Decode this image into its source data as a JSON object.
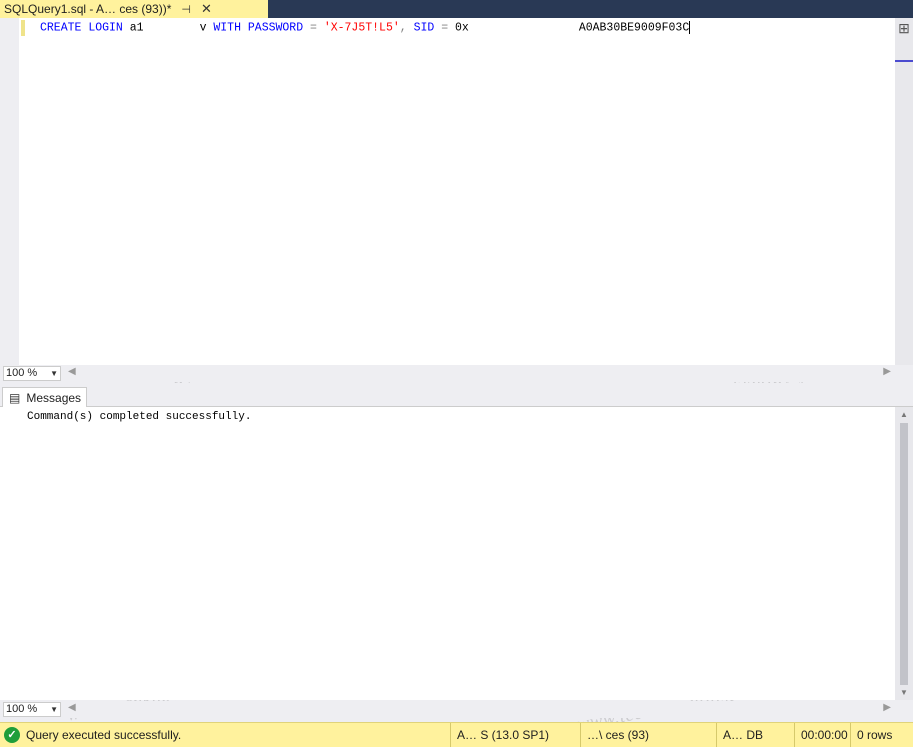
{
  "tab": {
    "title": "SQLQuery1.sql - A…                ces (93))*",
    "pin_glyph": "⊣",
    "close_glyph": "✕"
  },
  "editor": {
    "tokens": {
      "create": "CREATE",
      "login": "LOGIN",
      "name_part1": "a1",
      "name_part2": "v",
      "with": "WITH",
      "password": "PASSWORD",
      "eq1": "=",
      "pwd_value": "'X-7J5T!L5'",
      "comma": ",",
      "sid": "SID",
      "eq2": "=",
      "sid_part1": "0x",
      "sid_part2": "A0AB30BE9009F03C"
    }
  },
  "editor_zoom": {
    "value": "100 %"
  },
  "results": {
    "tab_label": "Messages",
    "message": "Command(s) completed successfully."
  },
  "results_zoom": {
    "value": "100 %"
  },
  "status": {
    "text": "Query executed successfully.",
    "server_version": "A…             S (13.0 SP1)",
    "user": "…\\             ces (93)",
    "database": "A…           DB",
    "elapsed": "00:00:00",
    "rows": "0 rows"
  },
  "watermark": {
    "text": "www.techknowlojist.com"
  }
}
